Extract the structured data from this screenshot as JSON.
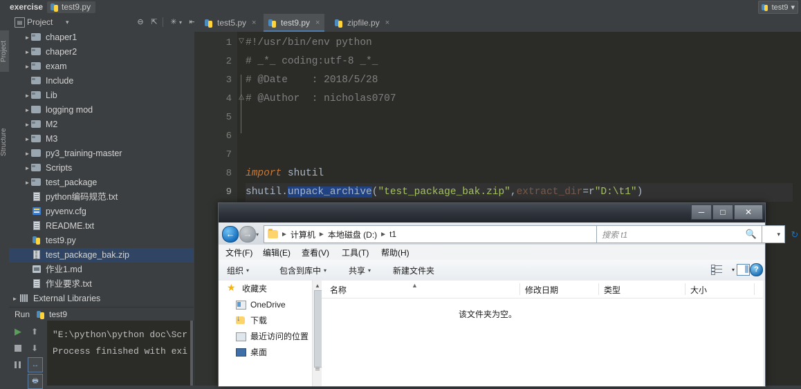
{
  "ide": {
    "breadcrumb": {
      "project": "exercise",
      "file": "test9.py"
    },
    "top_right": {
      "run_config": "test9",
      "caret": "▾"
    },
    "left_tabs": {
      "project": "Project",
      "structure": "Structure"
    },
    "project_panel": {
      "title": "Project",
      "caret": "▾",
      "buttons": [
        "collapse-all",
        "expand-all",
        "settings",
        "hide"
      ],
      "tree": [
        {
          "label": "chaper1",
          "icon": "folder",
          "arrow": "►",
          "indent": 1,
          "selected": false
        },
        {
          "label": "chaper2",
          "icon": "folder",
          "arrow": "►",
          "indent": 1,
          "selected": false
        },
        {
          "label": "exam",
          "icon": "folder",
          "arrow": "►",
          "indent": 1,
          "selected": false
        },
        {
          "label": "Include",
          "icon": "folder",
          "arrow": "",
          "indent": 1,
          "selected": false
        },
        {
          "label": "Lib",
          "icon": "folder",
          "arrow": "►",
          "indent": 1,
          "selected": false
        },
        {
          "label": "logging mod",
          "icon": "folder-plain",
          "arrow": "►",
          "indent": 1,
          "selected": false
        },
        {
          "label": "M2",
          "icon": "folder",
          "arrow": "►",
          "indent": 1,
          "selected": false
        },
        {
          "label": "M3",
          "icon": "folder",
          "arrow": "►",
          "indent": 1,
          "selected": false
        },
        {
          "label": "py3_training-master",
          "icon": "folder-plain",
          "arrow": "►",
          "indent": 1,
          "selected": false
        },
        {
          "label": "Scripts",
          "icon": "folder",
          "arrow": "►",
          "indent": 1,
          "selected": false
        },
        {
          "label": "test_package",
          "icon": "folder",
          "arrow": "►",
          "indent": 1,
          "selected": false
        },
        {
          "label": "python编码规范.txt",
          "icon": "txt",
          "arrow": "",
          "indent": 1,
          "selected": false
        },
        {
          "label": "pyvenv.cfg",
          "icon": "cfg",
          "arrow": "",
          "indent": 1,
          "selected": false
        },
        {
          "label": "README.txt",
          "icon": "txt",
          "arrow": "",
          "indent": 1,
          "selected": false
        },
        {
          "label": "test9.py",
          "icon": "py",
          "arrow": "",
          "indent": 1,
          "selected": false
        },
        {
          "label": "test_package_bak.zip",
          "icon": "zip",
          "arrow": "",
          "indent": 1,
          "selected": true
        },
        {
          "label": "作业1.md",
          "icon": "md",
          "arrow": "",
          "indent": 1,
          "selected": false
        },
        {
          "label": "作业要求.txt",
          "icon": "txt",
          "arrow": "",
          "indent": 1,
          "selected": false
        },
        {
          "label": "External Libraries",
          "icon": "lib",
          "arrow": "►",
          "indent": 0,
          "selected": false
        }
      ]
    },
    "editor_tabs": [
      {
        "label": "test5.py",
        "close": "×",
        "active": false
      },
      {
        "label": "test9.py",
        "close": "×",
        "active": true
      },
      {
        "label": "zipfile.py",
        "close": "×",
        "active": false
      }
    ],
    "editor": {
      "line_numbers": [
        "1",
        "2",
        "3",
        "4",
        "5",
        "6",
        "7",
        "8",
        "9"
      ],
      "active_line": 9,
      "lines": [
        {
          "n": 1,
          "segs": [
            {
              "t": "#!/usr/bin/env python",
              "c": "cmt"
            }
          ]
        },
        {
          "n": 2,
          "segs": [
            {
              "t": "# _*_ coding:utf-8 _*_",
              "c": "cmt"
            }
          ]
        },
        {
          "n": 3,
          "segs": [
            {
              "t": "# @Date    : 2018/5/28",
              "c": "cmt"
            }
          ]
        },
        {
          "n": 4,
          "segs": [
            {
              "t": "# @Author  : nicholas0707",
              "c": "cmt"
            }
          ]
        },
        {
          "n": 5,
          "segs": []
        },
        {
          "n": 6,
          "segs": []
        },
        {
          "n": 7,
          "segs": []
        },
        {
          "n": 8,
          "segs": [
            {
              "t": "import",
              "c": "kw"
            },
            {
              "t": " shutil",
              "c": "plain"
            }
          ]
        },
        {
          "n": 9,
          "segs": [
            {
              "t": "shutil.",
              "c": "plain"
            },
            {
              "t": "unpack_archive",
              "c": "fn selhl"
            },
            {
              "t": "(",
              "c": "plain"
            },
            {
              "t": "\"test_package_bak.zip\"",
              "c": "str"
            },
            {
              "t": ",",
              "c": "plain"
            },
            {
              "t": "extract_dir",
              "c": "param"
            },
            {
              "t": "=r",
              "c": "plain"
            },
            {
              "t": "\"D:\\t1\"",
              "c": "str"
            },
            {
              "t": ")",
              "c": "plain"
            }
          ]
        }
      ]
    },
    "run_panel": {
      "title": "Run",
      "config_name": "test9",
      "console_lines": [
        "\"E:\\python\\python doc\\Scr",
        "Process finished with exi"
      ],
      "buttons": [
        "rerun",
        "stop",
        "pause",
        "up-stack",
        "down-stack",
        "soft-wrap",
        "print"
      ]
    }
  },
  "explorer": {
    "window_controls": {
      "minimize": "─",
      "maximize": "□",
      "close": "✕"
    },
    "nav": {
      "back": "←",
      "forward": "→",
      "history_caret": "▾",
      "refresh": "↻",
      "address_caret": "▾"
    },
    "address_crumbs": [
      "计算机",
      "本地磁盘 (D:)",
      "t1"
    ],
    "crumb_sep": "►",
    "search_placeholder": "搜索 t1",
    "menubar": [
      "文件(F)",
      "编辑(E)",
      "查看(V)",
      "工具(T)",
      "帮助(H)"
    ],
    "toolbar": [
      {
        "label": "组织",
        "caret": "▾"
      },
      {
        "label": "包含到库中",
        "caret": "▾"
      },
      {
        "label": "共享",
        "caret": "▾"
      },
      {
        "label": "新建文件夹",
        "caret": ""
      }
    ],
    "toolbar_right": {
      "view_caret": "▾",
      "preview_pane": "preview-pane",
      "help": "?"
    },
    "nav_pane": [
      {
        "label": "收藏夹",
        "icon": "star"
      },
      {
        "label": "OneDrive",
        "icon": "onedrive"
      },
      {
        "label": "下载",
        "icon": "download"
      },
      {
        "label": "最近访问的位置",
        "icon": "recent"
      },
      {
        "label": "桌面",
        "icon": "desktop"
      }
    ],
    "columns": [
      "名称",
      "修改日期",
      "类型",
      "大小"
    ],
    "sort_indicator": "▲",
    "empty_message": "该文件夹为空。"
  },
  "colors": {
    "ide_bg": "#3c3f41",
    "editor_bg": "#2b2b28",
    "selection_blue": "#2f4563",
    "accent_tab": "#4f7dab",
    "keyword": "#cc7832",
    "string": "#a5c261",
    "comment": "#808080",
    "explorer_bg": "#f0f0f0"
  }
}
